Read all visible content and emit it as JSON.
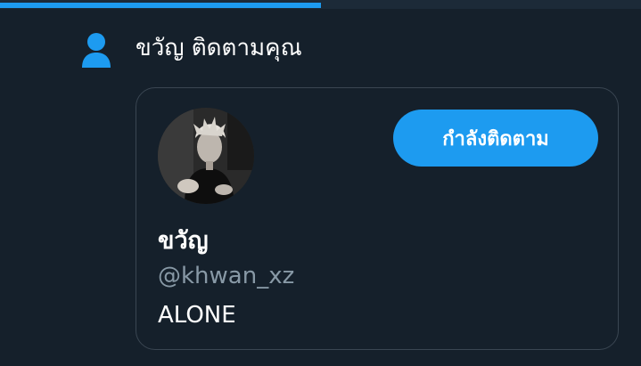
{
  "progress": {
    "fraction": 0.5
  },
  "notification": {
    "icon": "person-icon",
    "text": "ขวัญ ติดตามคุณ"
  },
  "user_card": {
    "avatar": "avatar-photo",
    "display_name": "ขวัญ",
    "handle": "@khwan_xz",
    "bio": "ALONE",
    "follow_button_label": "กำลังติดตาม"
  },
  "colors": {
    "background": "#15202b",
    "accent": "#1d9bf0",
    "secondary_text": "#8899a6",
    "border": "#3a4652"
  }
}
